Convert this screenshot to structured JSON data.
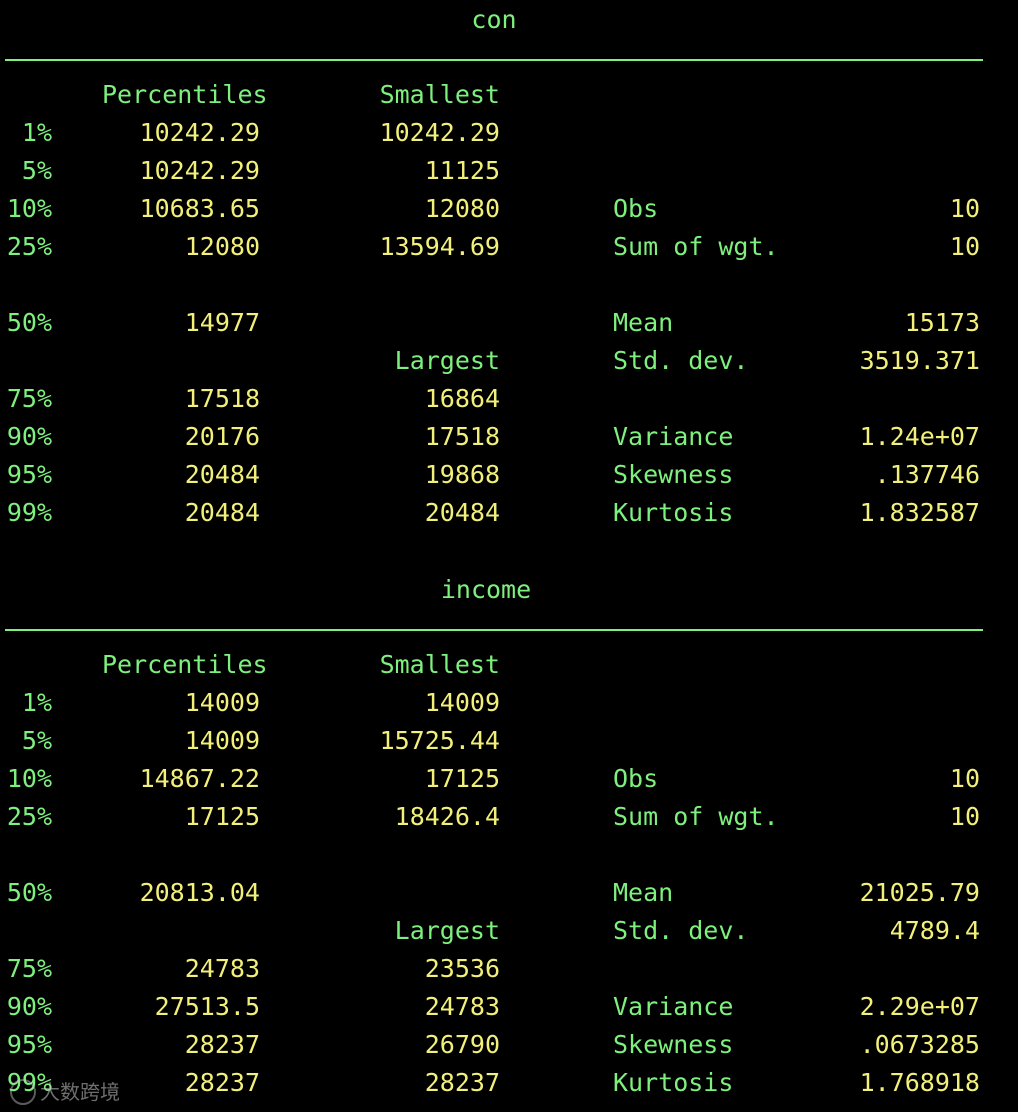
{
  "tables": [
    {
      "title": "con",
      "header": {
        "percentiles": "Percentiles",
        "smallest": "Smallest"
      },
      "rows": [
        {
          "pct": "1%",
          "perc": "10242.29",
          "ext": "10242.29",
          "stat": "",
          "val": ""
        },
        {
          "pct": "5%",
          "perc": "10242.29",
          "ext": "11125",
          "stat": "",
          "val": ""
        },
        {
          "pct": "10%",
          "perc": "10683.65",
          "ext": "12080",
          "stat": "Obs",
          "val": "10"
        },
        {
          "pct": "25%",
          "perc": "12080",
          "ext": "13594.69",
          "stat": "Sum of wgt.",
          "val": "10"
        },
        {
          "pct": "",
          "perc": "",
          "ext": "",
          "stat": "",
          "val": ""
        },
        {
          "pct": "50%",
          "perc": "14977",
          "ext": "",
          "stat": "Mean",
          "val": "15173"
        },
        {
          "pct": "",
          "perc": "",
          "ext": "Largest",
          "stat": "Std. dev.",
          "val": "3519.371"
        },
        {
          "pct": "75%",
          "perc": "17518",
          "ext": "16864",
          "stat": "",
          "val": ""
        },
        {
          "pct": "90%",
          "perc": "20176",
          "ext": "17518",
          "stat": "Variance",
          "val": "1.24e+07"
        },
        {
          "pct": "95%",
          "perc": "20484",
          "ext": "19868",
          "stat": "Skewness",
          "val": ".137746"
        },
        {
          "pct": "99%",
          "perc": "20484",
          "ext": "20484",
          "stat": "Kurtosis",
          "val": "1.832587"
        }
      ]
    },
    {
      "title": "income",
      "header": {
        "percentiles": "Percentiles",
        "smallest": "Smallest"
      },
      "rows": [
        {
          "pct": "1%",
          "perc": "14009",
          "ext": "14009",
          "stat": "",
          "val": ""
        },
        {
          "pct": "5%",
          "perc": "14009",
          "ext": "15725.44",
          "stat": "",
          "val": ""
        },
        {
          "pct": "10%",
          "perc": "14867.22",
          "ext": "17125",
          "stat": "Obs",
          "val": "10"
        },
        {
          "pct": "25%",
          "perc": "17125",
          "ext": "18426.4",
          "stat": "Sum of wgt.",
          "val": "10"
        },
        {
          "pct": "",
          "perc": "",
          "ext": "",
          "stat": "",
          "val": ""
        },
        {
          "pct": "50%",
          "perc": "20813.04",
          "ext": "",
          "stat": "Mean",
          "val": "21025.79"
        },
        {
          "pct": "",
          "perc": "",
          "ext": "Largest",
          "stat": "Std. dev.",
          "val": "4789.4"
        },
        {
          "pct": "75%",
          "perc": "24783",
          "ext": "23536",
          "stat": "",
          "val": ""
        },
        {
          "pct": "90%",
          "perc": "27513.5",
          "ext": "24783",
          "stat": "Variance",
          "val": "2.29e+07"
        },
        {
          "pct": "95%",
          "perc": "28237",
          "ext": "26790",
          "stat": "Skewness",
          "val": ".0673285"
        },
        {
          "pct": "99%",
          "perc": "28237",
          "ext": "28237",
          "stat": "Kurtosis",
          "val": "1.768918"
        }
      ]
    }
  ],
  "colors": {
    "label": "#7ef07e",
    "value": "#f2f07a",
    "background": "#000000"
  },
  "watermark": {
    "text": "大数跨境"
  }
}
